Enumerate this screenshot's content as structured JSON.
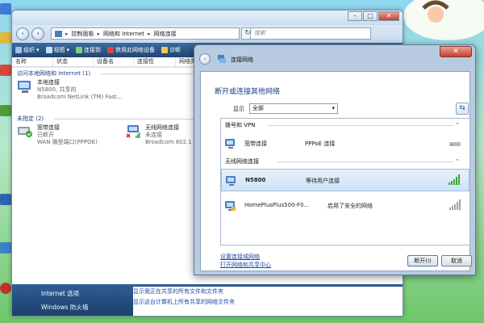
{
  "explorer": {
    "breadcrumb": [
      "控制面板",
      "网络和 Internet",
      "网络连接"
    ],
    "search_placeholder": "搜索",
    "window_buttons": {
      "minimize": "–",
      "maximize": "□",
      "close": "✕"
    },
    "toolbar": [
      "组织",
      "视图",
      "连接到",
      "禁用此网络设备",
      "诊断"
    ],
    "columns": [
      "名称",
      "状态",
      "设备名",
      "连接性",
      "网络类"
    ],
    "groups": [
      {
        "title": "访问本地网络和 Internet (1)"
      },
      {
        "title": "未指定 (2)"
      }
    ],
    "connections": {
      "local": {
        "name": "本地连接",
        "status": "N5800, 共享的",
        "device": "Broadcom NetLink (TM) Fast..."
      },
      "broadband": {
        "name": "宽带连接",
        "status": "已断开",
        "device": "WAN 微型端口(PPPOE)"
      },
      "wireless": {
        "name": "无线网络连接",
        "status": "未连接",
        "device": "Broadcom 802.1"
      }
    },
    "details_left": [
      "Internet 选项",
      "Windows 防火墙"
    ],
    "details_right": [
      "显示我正在共享的所有文件和文件夹",
      "显示这台计算机上所有共享的网络文件夹"
    ]
  },
  "dialog": {
    "title": "连接网络",
    "heading": "断开或连接其他网络",
    "show_label": "显示",
    "show_value": "全部",
    "sections": [
      {
        "title": "拨号和 VPN",
        "items": [
          {
            "name": "宽带连接",
            "state": "PPPoE 连接",
            "icon": "modem-icon"
          }
        ]
      },
      {
        "title": "无线网络连接",
        "items": [
          {
            "name": "N5800",
            "state": "等待用户连接",
            "icon": "signal-strong-icon",
            "selected": true
          },
          {
            "name": "HomePlusPlus500-F0...",
            "state": "启用了安全的网络",
            "icon": "signal-gray-icon"
          }
        ]
      }
    ],
    "links": [
      "设置连接或网络",
      "打开网络和共享中心"
    ],
    "buttons": {
      "connect": "断开(I)",
      "cancel": "取消"
    }
  },
  "colors": {
    "toolbar": "#1f4676",
    "link": "#1d49a8",
    "heading": "#1a3c84",
    "signal": "#3aa637"
  }
}
